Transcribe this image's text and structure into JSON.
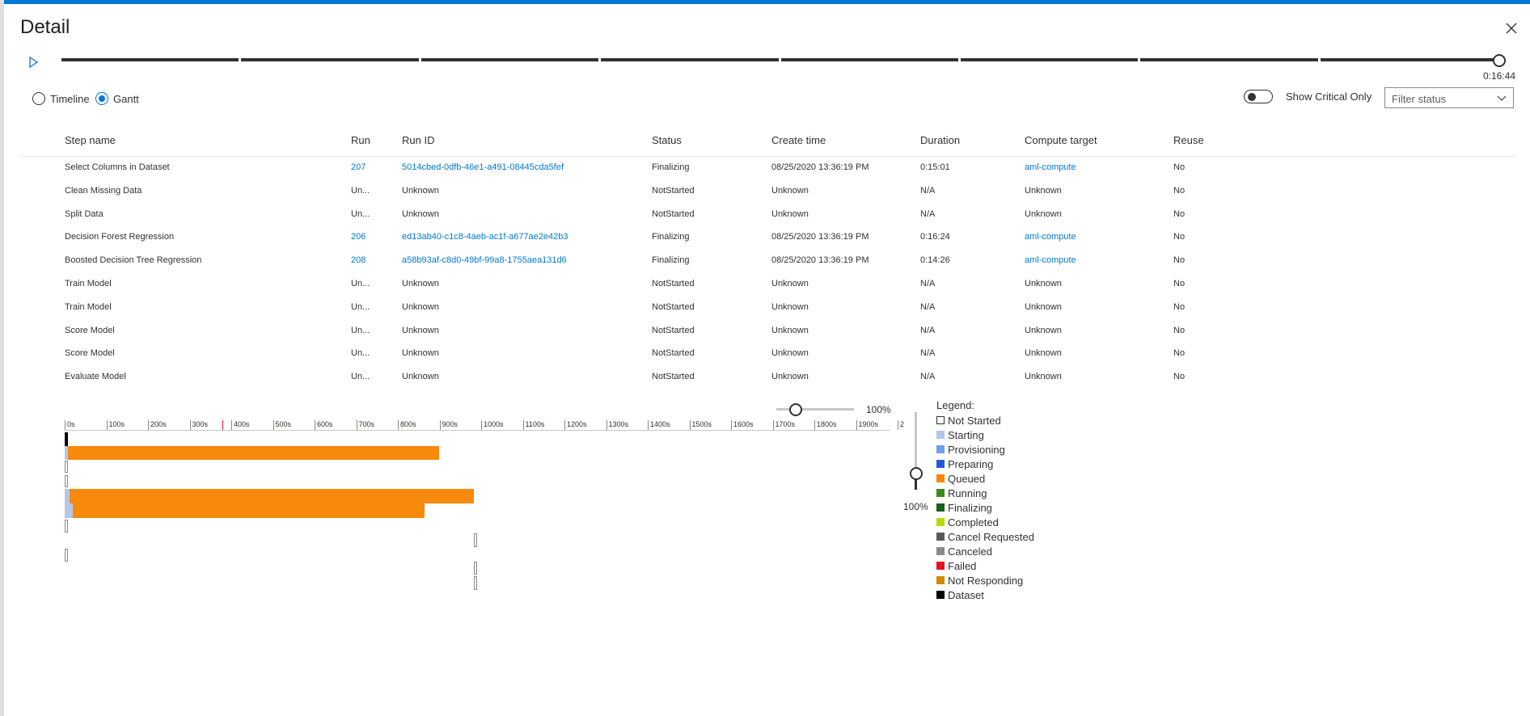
{
  "panel": {
    "title": "Detail"
  },
  "playback": {
    "end_time": "0:16:44"
  },
  "view_mode": {
    "timeline_label": "Timeline",
    "gantt_label": "Gantt",
    "selected": "Gantt"
  },
  "controls": {
    "critical_label": "Show Critical Only",
    "critical_on": false,
    "filter_placeholder": "Filter status"
  },
  "table": {
    "columns": [
      "Step name",
      "Run",
      "Run ID",
      "Status",
      "Create time",
      "Duration",
      "Compute target",
      "Reuse"
    ],
    "rows": [
      {
        "step": "Select Columns in Dataset",
        "run": "207",
        "run_id": "5014cbed-0dfb-46e1-a491-08445cda5fef",
        "status": "Finalizing",
        "create_time": "08/25/2020 13:36:19 PM",
        "duration": "0:15:01",
        "compute": "aml-compute",
        "reuse": "No"
      },
      {
        "step": "Clean Missing Data",
        "run": "Un...",
        "run_id": "Unknown",
        "status": "NotStarted",
        "create_time": "Unknown",
        "duration": "N/A",
        "compute": "Unknown",
        "reuse": "No"
      },
      {
        "step": "Split Data",
        "run": "Un...",
        "run_id": "Unknown",
        "status": "NotStarted",
        "create_time": "Unknown",
        "duration": "N/A",
        "compute": "Unknown",
        "reuse": "No"
      },
      {
        "step": "Decision Forest Regression",
        "run": "206",
        "run_id": "ed13ab40-c1c8-4aeb-ac1f-a677ae2e42b3",
        "status": "Finalizing",
        "create_time": "08/25/2020 13:36:19 PM",
        "duration": "0:16:24",
        "compute": "aml-compute",
        "reuse": "No"
      },
      {
        "step": "Boosted Decision Tree Regression",
        "run": "208",
        "run_id": "a58b93af-c8d0-49bf-99a8-1755aea131d6",
        "status": "Finalizing",
        "create_time": "08/25/2020 13:36:19 PM",
        "duration": "0:14:26",
        "compute": "aml-compute",
        "reuse": "No"
      },
      {
        "step": "Train Model",
        "run": "Un...",
        "run_id": "Unknown",
        "status": "NotStarted",
        "create_time": "Unknown",
        "duration": "N/A",
        "compute": "Unknown",
        "reuse": "No"
      },
      {
        "step": "Train Model",
        "run": "Un...",
        "run_id": "Unknown",
        "status": "NotStarted",
        "create_time": "Unknown",
        "duration": "N/A",
        "compute": "Unknown",
        "reuse": "No"
      },
      {
        "step": "Score Model",
        "run": "Un...",
        "run_id": "Unknown",
        "status": "NotStarted",
        "create_time": "Unknown",
        "duration": "N/A",
        "compute": "Unknown",
        "reuse": "No"
      },
      {
        "step": "Score Model",
        "run": "Un...",
        "run_id": "Unknown",
        "status": "NotStarted",
        "create_time": "Unknown",
        "duration": "N/A",
        "compute": "Unknown",
        "reuse": "No"
      },
      {
        "step": "Evaluate Model",
        "run": "Un...",
        "run_id": "Unknown",
        "status": "NotStarted",
        "create_time": "Unknown",
        "duration": "N/A",
        "compute": "Unknown",
        "reuse": "No"
      }
    ]
  },
  "gantt": {
    "ticks": [
      "0s",
      "100s",
      "200s",
      "300s",
      "400s",
      "500s",
      "600s",
      "700s",
      "800s",
      "900s",
      "1000s",
      "1100s",
      "1200s",
      "1300s",
      "1400s",
      "1500s",
      "1600s",
      "1700s",
      "1800s",
      "1900s",
      "2"
    ],
    "zoom_h": "100%",
    "zoom_v": "100%",
    "colors": {
      "queued": "#f7890c",
      "starting": "#b4c7e7",
      "dataset": "#000000",
      "notstarted": "#ffffff"
    }
  },
  "legend": {
    "title": "Legend:",
    "items": [
      {
        "label": "Not Started",
        "color": "#ffffff"
      },
      {
        "label": "Starting",
        "color": "#b4c7e7"
      },
      {
        "label": "Provisioning",
        "color": "#6d9eeb"
      },
      {
        "label": "Preparing",
        "color": "#1f5bd6"
      },
      {
        "label": "Queued",
        "color": "#f7890c"
      },
      {
        "label": "Running",
        "color": "#3a8a1e"
      },
      {
        "label": "Finalizing",
        "color": "#1c5d1c"
      },
      {
        "label": "Completed",
        "color": "#bad80a"
      },
      {
        "label": "Cancel Requested",
        "color": "#5a5a5a"
      },
      {
        "label": "Canceled",
        "color": "#8a8a8a"
      },
      {
        "label": "Failed",
        "color": "#e81123"
      },
      {
        "label": "Not Responding",
        "color": "#d08b00"
      },
      {
        "label": "Dataset",
        "color": "#000000"
      }
    ]
  }
}
